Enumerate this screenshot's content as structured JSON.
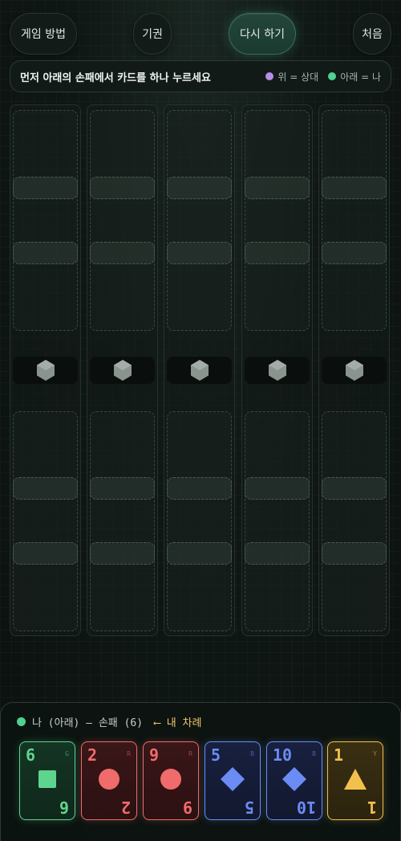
{
  "topbar": {
    "rules": "게임 방법",
    "forfeit": "기권",
    "restart": "다시 하기",
    "home": "처음"
  },
  "instruction": {
    "message": "먼저 아래의 손패에서 카드를 하나 누르세요",
    "legend_top": "위 = 상대",
    "legend_bottom": "아래 = 나",
    "legend_top_color": "#b58ee6",
    "legend_bottom_color": "#4fd18f"
  },
  "hand": {
    "title": "나 (아래) — 손패 (6)",
    "turn": "⟵ 내 차례",
    "cards": [
      {
        "value": "6",
        "code": "G",
        "shape": "square",
        "color": "#5fd48f",
        "bg": "#143524"
      },
      {
        "value": "2",
        "code": "R",
        "shape": "circle",
        "color": "#f06b6b",
        "bg": "#3a1618"
      },
      {
        "value": "9",
        "code": "R",
        "shape": "circle",
        "color": "#f06b6b",
        "bg": "#3a1618"
      },
      {
        "value": "5",
        "code": "B",
        "shape": "diamond",
        "color": "#6b8cf4",
        "bg": "#18203f"
      },
      {
        "value": "10",
        "code": "B",
        "shape": "diamond",
        "color": "#6b8cf4",
        "bg": "#18203f"
      },
      {
        "value": "1",
        "code": "Y",
        "shape": "triangle",
        "color": "#f2c04d",
        "bg": "#3a2f12"
      }
    ]
  }
}
